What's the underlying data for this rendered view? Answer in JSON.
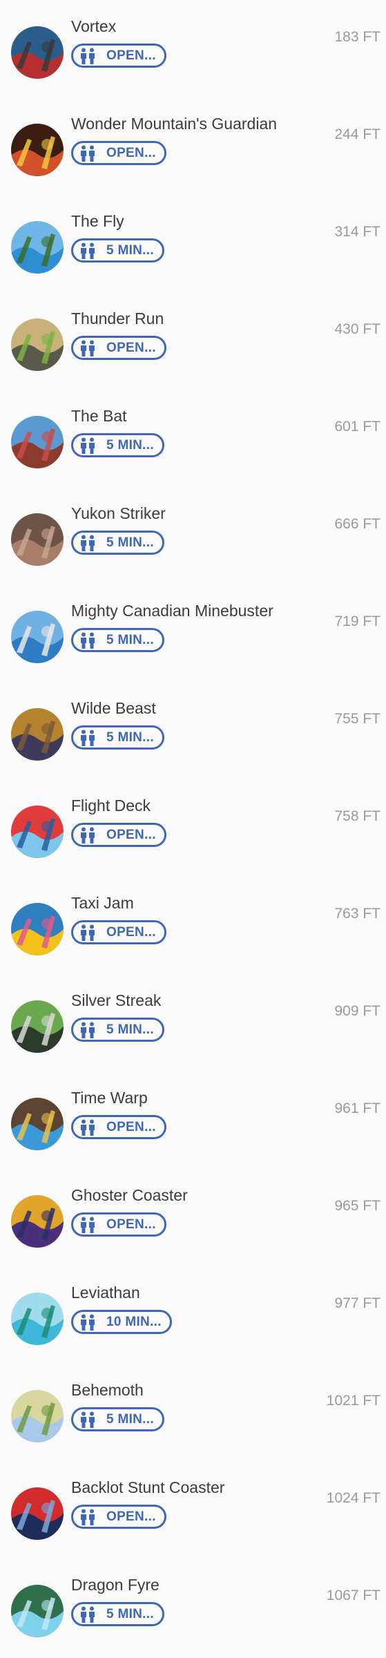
{
  "rides": [
    {
      "name": "Vortex",
      "wait": "OPEN...",
      "distance": "183 FT",
      "thumb": "ride-photo-vortex-icon",
      "colors": [
        "#b52f2f",
        "#2b5d8c",
        "#3a3a3a"
      ]
    },
    {
      "name": "Wonder Mountain's Guardian",
      "wait": "OPEN...",
      "distance": "244 FT",
      "thumb": "ride-photo-guardian-icon",
      "colors": [
        "#d2502a",
        "#3b1d12",
        "#f4c542"
      ]
    },
    {
      "name": "The Fly",
      "wait": "5 MIN...",
      "distance": "314 FT",
      "thumb": "ride-photo-the-fly-icon",
      "colors": [
        "#2d8fd1",
        "#6eb6e8",
        "#3c6e2a"
      ]
    },
    {
      "name": "Thunder Run",
      "wait": "OPEN...",
      "distance": "430 FT",
      "thumb": "ride-photo-thunder-run-icon",
      "colors": [
        "#5a5a4a",
        "#c9b27a",
        "#7cb342"
      ]
    },
    {
      "name": "The Bat",
      "wait": "5 MIN...",
      "distance": "601 FT",
      "thumb": "ride-photo-the-bat-icon",
      "colors": [
        "#8c3b2f",
        "#5b9ad1",
        "#c94c4c"
      ]
    },
    {
      "name": "Yukon Striker",
      "wait": "5 MIN...",
      "distance": "666 FT",
      "thumb": "ride-photo-yukon-striker-icon",
      "colors": [
        "#a87d6a",
        "#6d5447",
        "#c6a58f"
      ]
    },
    {
      "name": "Mighty Canadian Minebuster",
      "wait": "5 MIN...",
      "distance": "719 FT",
      "thumb": "ride-photo-minebuster-icon",
      "colors": [
        "#2e7cc4",
        "#6fb1e3",
        "#e8e8e8"
      ]
    },
    {
      "name": "Wilde Beast",
      "wait": "5 MIN...",
      "distance": "755 FT",
      "thumb": "ride-photo-wilde-beast-icon",
      "colors": [
        "#3d3a5c",
        "#b5822e",
        "#7a5a3a"
      ]
    },
    {
      "name": "Flight Deck",
      "wait": "OPEN...",
      "distance": "758 FT",
      "thumb": "ride-photo-flight-deck-icon",
      "colors": [
        "#7cc6ec",
        "#e23b3b",
        "#2a5d9c"
      ]
    },
    {
      "name": "Taxi Jam",
      "wait": "OPEN...",
      "distance": "763 FT",
      "thumb": "ride-photo-taxi-jam-icon",
      "colors": [
        "#f2c21b",
        "#2f7fbf",
        "#e05a8a"
      ]
    },
    {
      "name": "Silver Streak",
      "wait": "5 MIN...",
      "distance": "909 FT",
      "thumb": "ride-photo-silver-streak-icon",
      "colors": [
        "#2c3a2c",
        "#6aa84f",
        "#d7d7d7"
      ]
    },
    {
      "name": "Time Warp",
      "wait": "OPEN...",
      "distance": "961 FT",
      "thumb": "ride-photo-time-warp-icon",
      "colors": [
        "#3a9ad9",
        "#5c4432",
        "#e8c14a"
      ]
    },
    {
      "name": "Ghoster Coaster",
      "wait": "OPEN...",
      "distance": "965 FT",
      "thumb": "ride-photo-ghoster-coaster-icon",
      "colors": [
        "#4a2f7a",
        "#e0a52a",
        "#2e2e6a"
      ]
    },
    {
      "name": "Leviathan",
      "wait": "10 MIN...",
      "distance": "977 FT",
      "thumb": "ride-photo-leviathan-icon",
      "colors": [
        "#3fb7d9",
        "#9fdcec",
        "#1e8c74"
      ]
    },
    {
      "name": "Behemoth",
      "wait": "5 MIN...",
      "distance": "1021 FT",
      "thumb": "ride-photo-behemoth-icon",
      "colors": [
        "#a9c9ea",
        "#d9d7a0",
        "#6f9a43"
      ]
    },
    {
      "name": "Backlot Stunt Coaster",
      "wait": "OPEN...",
      "distance": "1024 FT",
      "thumb": "ride-photo-backlot-stunt-icon",
      "colors": [
        "#1d2c5a",
        "#d22b2b",
        "#7aa8d8"
      ]
    },
    {
      "name": "Dragon Fyre",
      "wait": "5 MIN...",
      "distance": "1067 FT",
      "thumb": "ride-photo-dragon-fyre-icon",
      "colors": [
        "#7fd0ea",
        "#2f6f4a",
        "#bfe7f3"
      ]
    }
  ],
  "theme": {
    "accent": "#3f67b8",
    "text": "#3c3c3c",
    "distance": "#9a9a9a",
    "background": "#fafafa"
  }
}
